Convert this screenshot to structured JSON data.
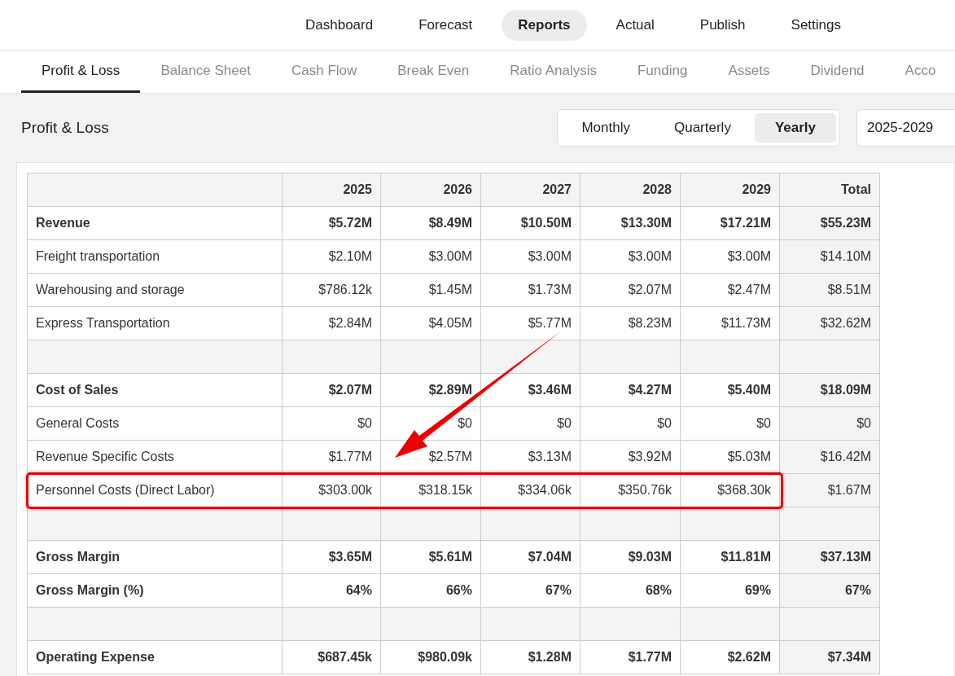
{
  "nav": [
    {
      "label": "Dashboard",
      "selected": false
    },
    {
      "label": "Forecast",
      "selected": false
    },
    {
      "label": "Reports",
      "selected": true
    },
    {
      "label": "Actual",
      "selected": false
    },
    {
      "label": "Publish",
      "selected": false
    },
    {
      "label": "Settings",
      "selected": false
    }
  ],
  "tabs": [
    {
      "label": "Profit & Loss",
      "selected": true
    },
    {
      "label": "Balance Sheet",
      "selected": false
    },
    {
      "label": "Cash Flow",
      "selected": false
    },
    {
      "label": "Break Even",
      "selected": false
    },
    {
      "label": "Ratio Analysis",
      "selected": false
    },
    {
      "label": "Funding",
      "selected": false
    },
    {
      "label": "Assets",
      "selected": false
    },
    {
      "label": "Dividend",
      "selected": false
    },
    {
      "label": "Acco",
      "selected": false
    }
  ],
  "title": "Profit & Loss",
  "periods": [
    {
      "label": "Monthly",
      "selected": false
    },
    {
      "label": "Quarterly",
      "selected": false
    },
    {
      "label": "Yearly",
      "selected": true
    }
  ],
  "date_range": "2025-2029",
  "table": {
    "columns": [
      "2025",
      "2026",
      "2027",
      "2028",
      "2029",
      "Total"
    ],
    "rows": [
      {
        "kind": "group",
        "label": "Revenue",
        "values": [
          "$5.72M",
          "$8.49M",
          "$10.50M",
          "$13.30M",
          "$17.21M",
          "$55.23M"
        ],
        "highlighted": false
      },
      {
        "kind": "item",
        "label": "Freight transportation",
        "values": [
          "$2.10M",
          "$3.00M",
          "$3.00M",
          "$3.00M",
          "$3.00M",
          "$14.10M"
        ],
        "highlighted": false
      },
      {
        "kind": "item",
        "label": "Warehousing and storage",
        "values": [
          "$786.12k",
          "$1.45M",
          "$1.73M",
          "$2.07M",
          "$2.47M",
          "$8.51M"
        ],
        "highlighted": false
      },
      {
        "kind": "item",
        "label": "Express Transportation",
        "values": [
          "$2.84M",
          "$4.05M",
          "$5.77M",
          "$8.23M",
          "$11.73M",
          "$32.62M"
        ],
        "highlighted": false
      },
      {
        "kind": "spacer",
        "highlighted": false
      },
      {
        "kind": "group",
        "label": "Cost of Sales",
        "values": [
          "$2.07M",
          "$2.89M",
          "$3.46M",
          "$4.27M",
          "$5.40M",
          "$18.09M"
        ],
        "highlighted": false
      },
      {
        "kind": "item",
        "label": "General Costs",
        "values": [
          "$0",
          "$0",
          "$0",
          "$0",
          "$0",
          "$0"
        ],
        "highlighted": false
      },
      {
        "kind": "item",
        "label": "Revenue Specific Costs",
        "values": [
          "$1.77M",
          "$2.57M",
          "$3.13M",
          "$3.92M",
          "$5.03M",
          "$16.42M"
        ],
        "highlighted": false
      },
      {
        "kind": "item",
        "label": "Personnel Costs (Direct Labor)",
        "values": [
          "$303.00k",
          "$318.15k",
          "$334.06k",
          "$350.76k",
          "$368.30k",
          "$1.67M"
        ],
        "highlighted": true
      },
      {
        "kind": "spacer",
        "highlighted": false
      },
      {
        "kind": "group",
        "label": "Gross Margin",
        "values": [
          "$3.65M",
          "$5.61M",
          "$7.04M",
          "$9.03M",
          "$11.81M",
          "$37.13M"
        ],
        "highlighted": false
      },
      {
        "kind": "group",
        "label": "Gross Margin (%)",
        "values": [
          "64%",
          "66%",
          "67%",
          "68%",
          "69%",
          "67%"
        ],
        "highlighted": false
      },
      {
        "kind": "spacer",
        "highlighted": false
      },
      {
        "kind": "group",
        "label": "Operating Expense",
        "values": [
          "$687.45k",
          "$980.09k",
          "$1.28M",
          "$1.77M",
          "$2.62M",
          "$7.34M"
        ],
        "highlighted": false
      }
    ]
  }
}
